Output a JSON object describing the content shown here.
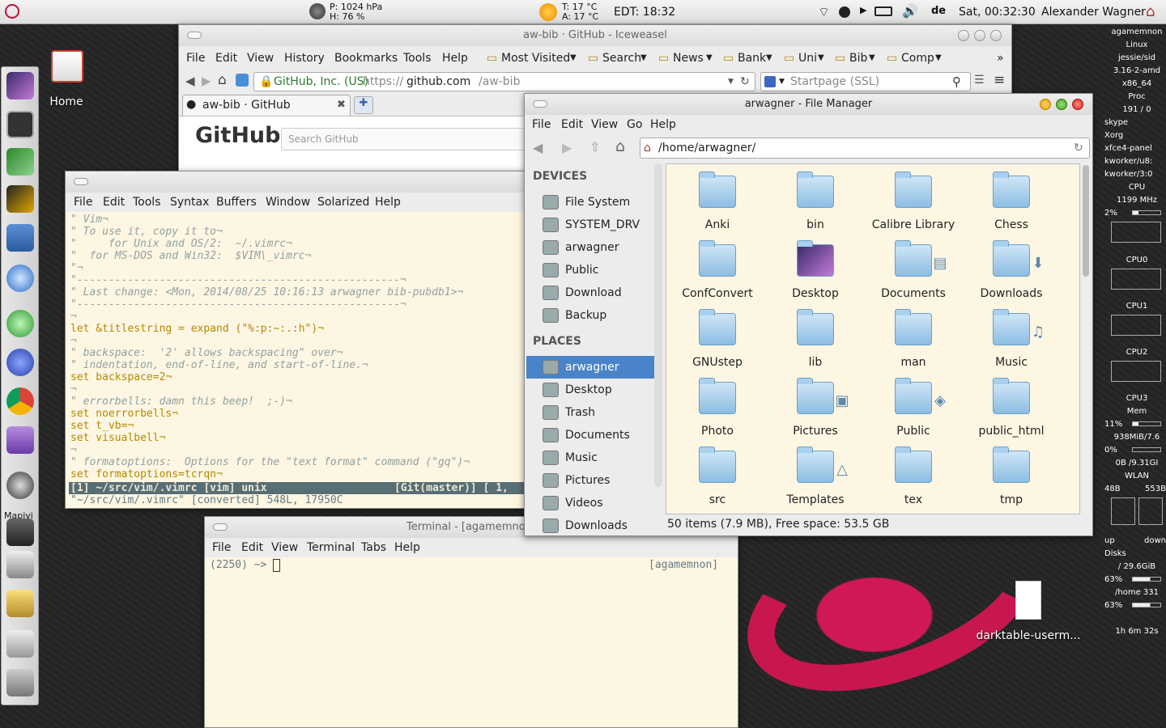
{
  "top_panel": {
    "pressure": "P: 1024 hPa",
    "humidity": "H: 76 %",
    "temp_t": "T: 17 °C",
    "temp_a": "A: 17 °C",
    "edt": "EDT: 18:32",
    "lang": "de",
    "datetime": "Sat, 00:32:30",
    "user": "Alexander Wagner"
  },
  "desktop": {
    "home_label": "Home",
    "mapivi_label": "Mapivi",
    "file_label": "darktable-userm..."
  },
  "browser": {
    "title": "aw-bib · GitHub - Iceweasel",
    "menu": [
      "File",
      "Edit",
      "View",
      "History",
      "Bookmarks",
      "Tools",
      "Help"
    ],
    "bookmarks": [
      "Most Visited",
      "Search",
      "News",
      "Bank",
      "Uni",
      "Bib",
      "Comp"
    ],
    "identity": "GitHub, Inc. (US)",
    "url_prefix": "https://",
    "url_host": "github.com",
    "url_path": "/aw-bib",
    "search_placeholder": "Startpage (SSL)",
    "tab_label": "aw-bib · GitHub",
    "page_logo": "GitHub",
    "page_search_placeholder": "Search GitHub"
  },
  "vim": {
    "menu": [
      "File",
      "Edit",
      "Tools",
      "Syntax",
      "Buffers",
      "Window",
      "Solarized",
      "Help"
    ],
    "lines": [
      {
        "t": "\" Vim¬",
        "c": "cm"
      },
      {
        "t": "\" To use it, copy it to¬",
        "c": "cm"
      },
      {
        "t": "\"     for Unix and OS/2:  ~/.vimrc¬",
        "c": "cm"
      },
      {
        "t": "\"  for MS-DOS and Win32:  $VIM\\_vimrc¬",
        "c": "cm"
      },
      {
        "t": "\"¬",
        "c": "cm"
      },
      {
        "t": "\"---------------------------------------------------¬",
        "c": "cm"
      },
      {
        "t": "\" Last change: <Mon, 2014/08/25 10:16:13 arwagner bib-pubdb1>¬",
        "c": "cm"
      },
      {
        "t": "\"---------------------------------------------------¬",
        "c": "cm"
      },
      {
        "t": "¬",
        "c": "cm"
      },
      {
        "t": "let &titlestring = expand (\"%:p:~:.:h\")¬",
        "c": "mix1"
      },
      {
        "t": "¬",
        "c": "cm"
      },
      {
        "t": "\" backspace:  '2' allows backspacing\" over¬",
        "c": "cm"
      },
      {
        "t": "\" indentation, end-of-line, and start-of-line.¬",
        "c": "cm"
      },
      {
        "t": "set backspace=2¬",
        "c": "set"
      },
      {
        "t": "¬",
        "c": "cm"
      },
      {
        "t": "\" errorbells: damn this beep!  ;-)¬",
        "c": "cm"
      },
      {
        "t": "set noerrorbells¬",
        "c": "set"
      },
      {
        "t": "set t_vb=¬",
        "c": "set"
      },
      {
        "t": "set visualbell¬",
        "c": "set"
      },
      {
        "t": "¬",
        "c": "cm"
      },
      {
        "t": "\" formatoptions:  Options for the \"text format\" command (\"gq\")¬",
        "c": "cm"
      },
      {
        "t": "set formatoptions=tcrqn¬",
        "c": "set"
      }
    ],
    "statusline_left": "[1] ~/src/vim/.vimrc [vim] unix",
    "statusline_right": "[Git(master)] [ 1,",
    "cmdline": "\"~/src/vim/.vimrc\" [converted] 548L, 17950C"
  },
  "terminal": {
    "title": "Terminal - [agamemnon]",
    "menu": [
      "File",
      "Edit",
      "View",
      "Terminal",
      "Tabs",
      "Help"
    ],
    "prompt": "(2250) ~>",
    "host": "[agamemnon]"
  },
  "filemanager": {
    "title": "arwagner - File Manager",
    "menu": [
      "File",
      "Edit",
      "View",
      "Go",
      "Help"
    ],
    "path": "/home/arwagner/",
    "devices_header": "DEVICES",
    "devices": [
      "File System",
      "SYSTEM_DRV",
      "arwagner",
      "Public",
      "Download",
      "Backup"
    ],
    "places_header": "PLACES",
    "places": [
      "arwagner",
      "Desktop",
      "Trash",
      "Documents",
      "Music",
      "Pictures",
      "Videos",
      "Downloads"
    ],
    "folders": [
      "Anki",
      "bin",
      "Calibre Library",
      "Chess",
      "ConfConvert",
      "Desktop",
      "Documents",
      "Downloads",
      "GNUstep",
      "lib",
      "man",
      "Music",
      "Photo",
      "Pictures",
      "Public",
      "public_html",
      "src",
      "Templates",
      "tex",
      "tmp"
    ],
    "status": "50 items (7.9 MB), Free space: 53.5 GB"
  },
  "conky": {
    "host": "agamemnon",
    "os": "Linux",
    "dist": "jessie/sid",
    "kernel": "3.16-2-amd",
    "arch": "x86_64",
    "proc_label": "Proc",
    "proc": "191 / 0",
    "procs": [
      "skype",
      "Xorg",
      "xfce4-panel",
      "kworker/u8:",
      "kworker/3:0"
    ],
    "cpu_label": "CPU",
    "freq": "1199 MHz",
    "cpu_pct": "2%",
    "cpu_labels": [
      "CPU0",
      "CPU1",
      "CPU2",
      "CPU3"
    ],
    "mem_label": "Mem",
    "mem_pct": "11%",
    "mem_used": "938MiB/7.6",
    "swap_pct": "0%",
    "swap": "0B  /9.31GI",
    "wlan_label": "WLAN",
    "wlan_up": "48B",
    "wlan_down": "553B",
    "up": "up",
    "down": "down",
    "disks_label": "Disks",
    "disk1": "/ 29.6GiB",
    "disk1_pct": "63%",
    "disk2": "/home 331",
    "disk2_pct": "63%",
    "uptime": "1h 6m 32s"
  }
}
